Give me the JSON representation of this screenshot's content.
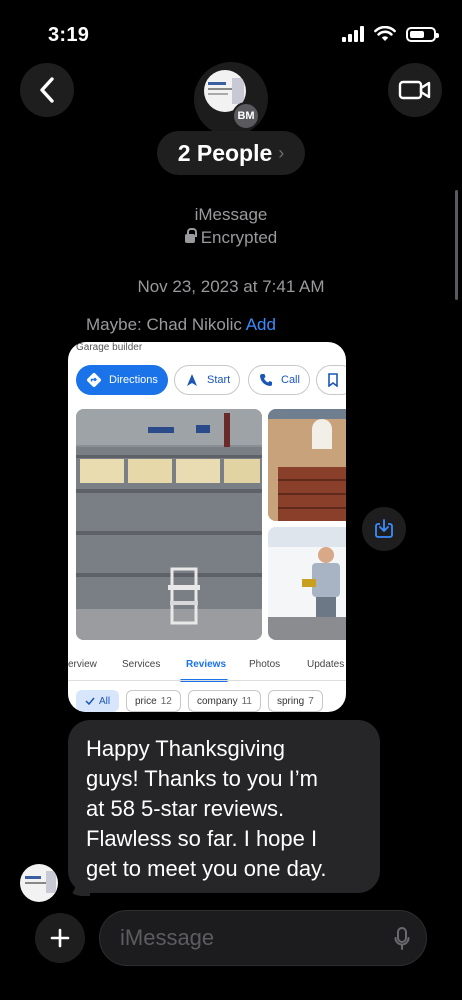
{
  "status_bar": {
    "time": "3:19"
  },
  "header": {
    "avatar_initials": "BM",
    "group_name": "2 People",
    "chevron": "›"
  },
  "conversation": {
    "service": "iMessage",
    "encryption": "Encrypted",
    "timestamp": "Nov 23, 2023 at 7:41 AM",
    "suggestion": {
      "prefix": "Maybe: Chad Nikolic",
      "action": "Add"
    }
  },
  "shared_card": {
    "label": "Garage builder",
    "actions": [
      "Directions",
      "Start",
      "Call"
    ],
    "tabs": [
      "erview",
      "Services",
      "Reviews",
      "Photos",
      "Updates"
    ],
    "active_tab": "Reviews",
    "filters": [
      {
        "label": "All",
        "count": ""
      },
      {
        "label": "price",
        "count": "12"
      },
      {
        "label": "company",
        "count": "11"
      },
      {
        "label": "spring",
        "count": "7"
      }
    ]
  },
  "message": {
    "lines": [
      "Happy Thanksgiving",
      "guys! Thanks to you I’m",
      "at 58 5-star reviews.",
      "Flawless so far. I hope I",
      "get to meet you one day."
    ]
  },
  "composer": {
    "placeholder": "iMessage"
  },
  "colors": {
    "accent": "#3b8cff",
    "bubble": "#262628",
    "maps_blue": "#1a73e8"
  }
}
